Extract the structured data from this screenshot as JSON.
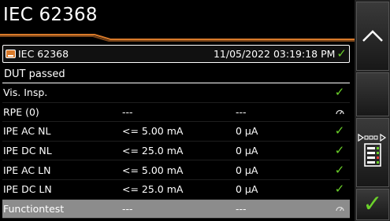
{
  "header": {
    "title": "IEC 62368"
  },
  "summary": {
    "name": "IEC 62368",
    "timestamp": "11/05/2022 03:19:18 PM",
    "status": "DUT passed"
  },
  "tests": [
    {
      "name": "Vis. Insp.",
      "limit": "",
      "value": "",
      "result": "pass"
    },
    {
      "name": "RPE (0)",
      "limit": "---",
      "value": "---",
      "result": "pending"
    },
    {
      "name": "IPE AC NL",
      "limit": "<= 5.00 mA",
      "value": "0 µA",
      "result": "pass"
    },
    {
      "name": "IPE DC NL",
      "limit": "<= 25.0 mA",
      "value": "0 µA",
      "result": "pass"
    },
    {
      "name": "IPE AC LN",
      "limit": "<= 5.00 mA",
      "value": "0 µA",
      "result": "pass"
    },
    {
      "name": "IPE DC LN",
      "limit": "<= 25.0 mA",
      "value": "0 µA",
      "result": "pass"
    },
    {
      "name": "Functiontest",
      "limit": "---",
      "value": "---",
      "result": "pending",
      "selected": true
    }
  ],
  "icons": {
    "pass": "checkmark-icon",
    "pending": "gauge-icon"
  },
  "colors": {
    "accent": "#d97a2a",
    "pass": "#6bd12a",
    "selected_row": "#8c8c8c"
  }
}
